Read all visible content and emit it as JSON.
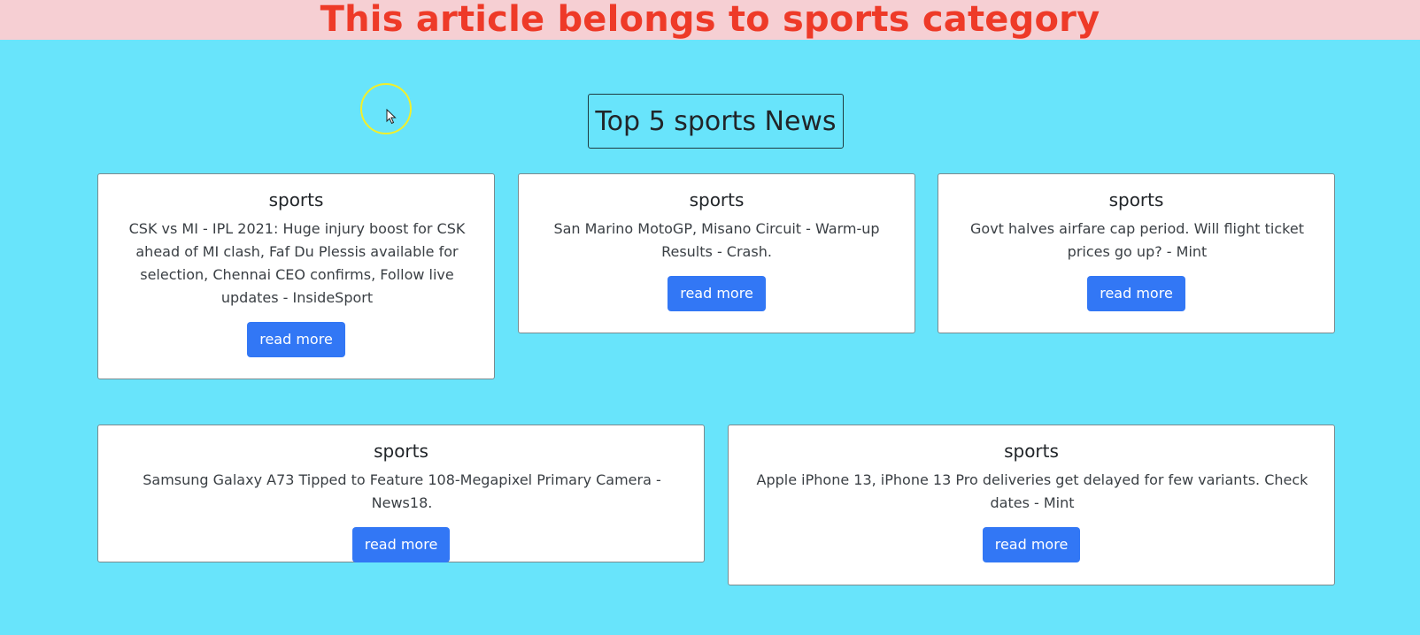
{
  "banner": {
    "text": "This article belongs to sports category"
  },
  "section": {
    "title": "Top 5 sports News"
  },
  "cards": [
    {
      "category": "sports",
      "headline": "CSK vs MI - IPL 2021: Huge injury boost for CSK ahead of MI clash, Faf Du Plessis available for selection, Chennai CEO confirms, Follow live updates - InsideSport",
      "button_label": "read more"
    },
    {
      "category": "sports",
      "headline": "San Marino MotoGP, Misano Circuit - Warm-up Results - Crash.",
      "button_label": "read more"
    },
    {
      "category": "sports",
      "headline": "Govt halves airfare cap period. Will flight ticket prices go up? - Mint",
      "button_label": "read more"
    },
    {
      "category": "sports",
      "headline": "Samsung Galaxy A73 Tipped to Feature 108-Megapixel Primary Camera - News18.",
      "button_label": "read more"
    },
    {
      "category": "sports",
      "headline": "Apple iPhone 13, iPhone 13 Pro deliveries get delayed for few variants. Check dates - Mint",
      "button_label": "read more"
    }
  ],
  "colors": {
    "background": "#68e4fb",
    "banner_background": "#f6cfd3",
    "banner_text": "#ee3a28",
    "button": "#3277f5"
  },
  "icons": {
    "cursor": "mouse-pointer-icon"
  }
}
